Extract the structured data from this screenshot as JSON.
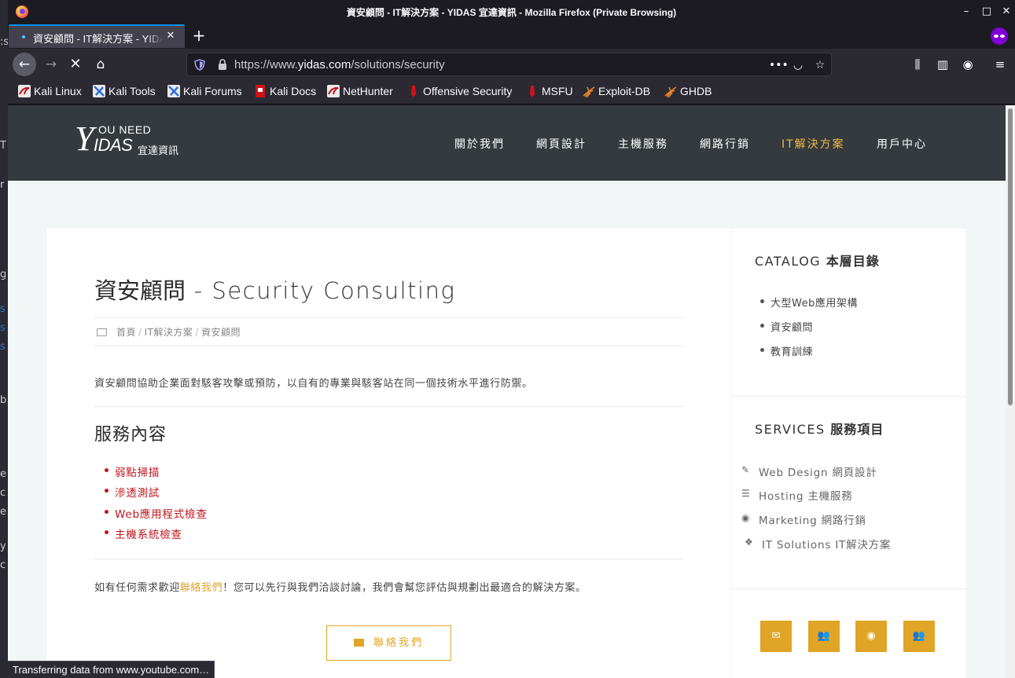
{
  "window": {
    "title": "資安顧問 - IT解決方案 - YIDAS 宜達資訊 - Mozilla Firefox (Private Browsing)",
    "minimize": "–",
    "maximize": "□",
    "close": "✕"
  },
  "tab": {
    "label": "資安顧問 - IT解決方案 - YIDAS 宜達資訊",
    "close": "✕",
    "new_tab": "+"
  },
  "toolbar": {
    "url_prefix": "https://www.",
    "url_host": "yidas.com",
    "url_path": "/solutions/security",
    "back": "←",
    "forward": "→",
    "stop": "✕",
    "home": "⌂",
    "page_actions": "•••",
    "pocket": "◡",
    "star": "☆",
    "library": "⫼",
    "sidebar": "▥",
    "account": "◉",
    "menu": "≡"
  },
  "bookmarks": [
    {
      "label": "Kali Linux"
    },
    {
      "label": "Kali Tools"
    },
    {
      "label": "Kali Forums"
    },
    {
      "label": "Kali Docs"
    },
    {
      "label": "NetHunter"
    },
    {
      "label": "Offensive Security"
    },
    {
      "label": "MSFU"
    },
    {
      "label": "Exploit-DB"
    },
    {
      "label": "GHDB"
    }
  ],
  "site": {
    "logo": {
      "y": "Y",
      "you_need": "OU NEED",
      "idas": "IDAS",
      "cn": "宜達資訊"
    },
    "menu": [
      {
        "label": "關於我們"
      },
      {
        "label": "網頁設計"
      },
      {
        "label": "主機服務"
      },
      {
        "label": "網路行銷"
      },
      {
        "label": "IT解決方案"
      },
      {
        "label": "用戶中心"
      }
    ],
    "accent_color": "#f0b84a",
    "header_bg": "#343a3d"
  },
  "article": {
    "title_cn": "資安顧問",
    "title_sep": " - ",
    "title_en": "Security Consulting",
    "breadcrumb": [
      "首頁",
      "IT解決方案",
      "資安顧問"
    ],
    "breadcrumb_sep": "/",
    "intro": "資安顧問協助企業面對駭客攻擊或預防，以自有的專業與駭客站在同一個技術水平進行防禦。",
    "services_heading": "服務內容",
    "services": [
      "弱點掃描",
      "滲透測試",
      "Web應用程式檢查",
      "主機系統檢查"
    ],
    "cta_before": "如有任何需求歡迎",
    "cta_link": "聯絡我們",
    "cta_after": "！您可以先行與我們洽談討論，我們會幫您評估與規劃出最適合的解決方案。",
    "contact_button": "聯絡我們"
  },
  "sidebar": {
    "catalog_en": "CATALOG",
    "catalog_cn": "本層目錄",
    "catalog_items": [
      "大型Web應用架構",
      "資安顧問",
      "教育訓練"
    ],
    "services_en": "SERVICES",
    "services_cn": "服務項目",
    "service_links": [
      {
        "en": "Web Design",
        "cn": "網頁設計",
        "icon": "edit-icon"
      },
      {
        "en": "Hosting",
        "cn": "主機服務",
        "icon": "server-icon"
      },
      {
        "en": "Marketing",
        "cn": "網路行銷",
        "icon": "telegram-icon"
      },
      {
        "en": "IT Solutions",
        "cn": "IT解決方案",
        "icon": "cubes-icon"
      }
    ],
    "social": [
      {
        "icon": "envelope-icon"
      },
      {
        "icon": "users-icon"
      },
      {
        "icon": "user-circle-icon"
      },
      {
        "icon": "users-icon"
      }
    ]
  },
  "status": "Transferring data from www.youtube.com…",
  "desktop_glyphs": [
    "T",
    "r",
    "g",
    "s",
    "s",
    "s",
    "b",
    "e",
    "c",
    "e",
    "y",
    "c"
  ]
}
